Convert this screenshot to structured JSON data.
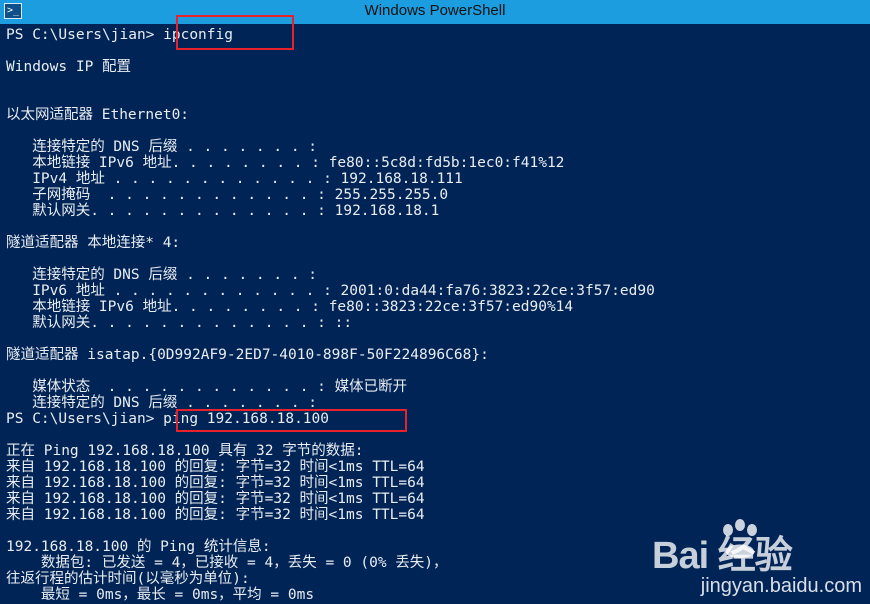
{
  "window": {
    "title": "Windows PowerShell",
    "icon": "powershell-icon"
  },
  "console": {
    "lines": [
      "PS C:\\Users\\jian> ipconfig",
      "",
      "Windows IP 配置",
      "",
      "",
      "以太网适配器 Ethernet0:",
      "",
      "   连接特定的 DNS 后缀 . . . . . . . :",
      "   本地链接 IPv6 地址. . . . . . . . : fe80::5c8d:fd5b:1ec0:f41%12",
      "   IPv4 地址 . . . . . . . . . . . . : 192.168.18.111",
      "   子网掩码  . . . . . . . . . . . . : 255.255.255.0",
      "   默认网关. . . . . . . . . . . . . : 192.168.18.1",
      "",
      "隧道适配器 本地连接* 4:",
      "",
      "   连接特定的 DNS 后缀 . . . . . . . :",
      "   IPv6 地址 . . . . . . . . . . . . : 2001:0:da44:fa76:3823:22ce:3f57:ed90",
      "   本地链接 IPv6 地址. . . . . . . . : fe80::3823:22ce:3f57:ed90%14",
      "   默认网关. . . . . . . . . . . . . : ::",
      "",
      "隧道适配器 isatap.{0D992AF9-2ED7-4010-898F-50F224896C68}:",
      "",
      "   媒体状态  . . . . . . . . . . . . : 媒体已断开",
      "   连接特定的 DNS 后缀 . . . . . . . :",
      "PS C:\\Users\\jian> ping 192.168.18.100",
      "",
      "正在 Ping 192.168.18.100 具有 32 字节的数据:",
      "来自 192.168.18.100 的回复: 字节=32 时间<1ms TTL=64",
      "来自 192.168.18.100 的回复: 字节=32 时间<1ms TTL=64",
      "来自 192.168.18.100 的回复: 字节=32 时间<1ms TTL=64",
      "来自 192.168.18.100 的回复: 字节=32 时间<1ms TTL=64",
      "",
      "192.168.18.100 的 Ping 统计信息:",
      "    数据包: 已发送 = 4，已接收 = 4，丢失 = 0 (0% 丢失)，",
      "往返行程的估计时间(以毫秒为单位):",
      "    最短 = 0ms，最长 = 0ms，平均 = 0ms"
    ]
  },
  "watermark": {
    "brand": "Bai  经验",
    "site": "jingyan.baidu.com"
  },
  "colors": {
    "console_bg": "#012456",
    "console_text": "#e9edf2",
    "titlebar": "#1b9de0",
    "highlight": "#e8222b"
  }
}
